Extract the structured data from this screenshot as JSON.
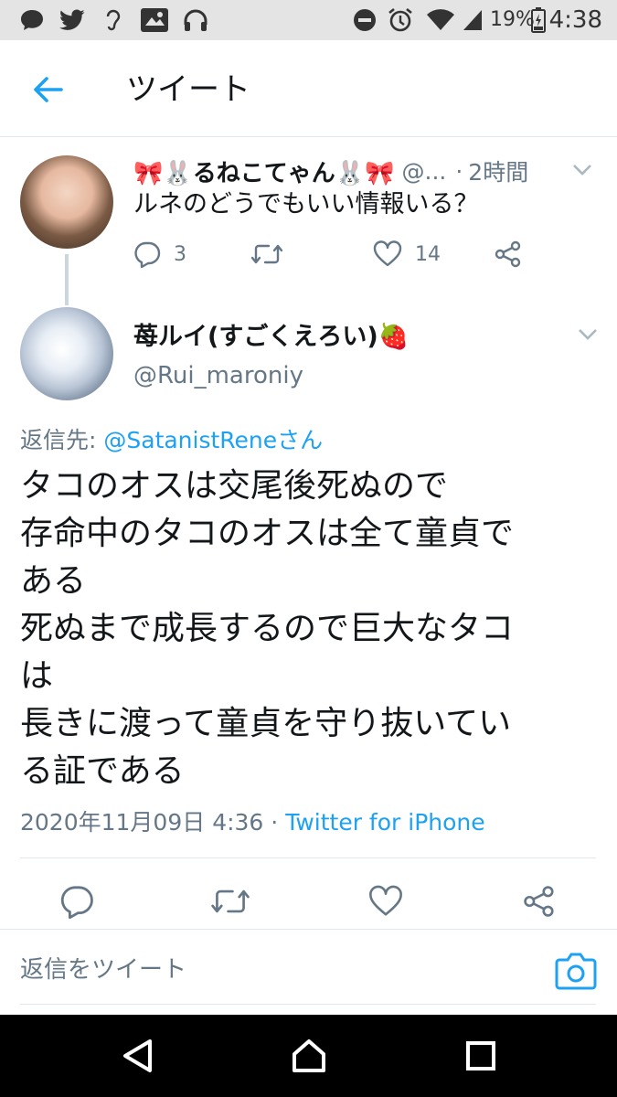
{
  "status_bar": {
    "battery": "19%",
    "time": "4:38"
  },
  "header": {
    "title": "ツイート"
  },
  "parent_tweet": {
    "name": "🎀🐰るねこてゃん🐰🎀",
    "handle": "@...",
    "separator": "·",
    "time": "2時間",
    "text": "ルネのどうでもいい情報いる？",
    "reply_count": "3",
    "like_count": "14"
  },
  "main_tweet": {
    "name": "苺ルイ(すごくえろい)🍓",
    "handle": "@Rui_maroniy",
    "reply_to_label": "返信先: ",
    "reply_to_handle": "@SatanistReneさん",
    "lines": [
      "タコのオスは交尾後死ぬので",
      "存命中のタコのオスは全て童貞で",
      "ある",
      "死ぬまで成長するので巨大なタコ",
      "は",
      "長きに渡って童貞を守り抜いてい",
      "る証である"
    ],
    "timestamp": "2020年11月09日 4:36",
    "meta_separator": " · ",
    "source": "Twitter for iPhone"
  },
  "reply_box": {
    "placeholder": "返信をツイート"
  },
  "colors": {
    "accent": "#1da1f2",
    "secondary_text": "#657786",
    "border": "#e1e8ed"
  }
}
